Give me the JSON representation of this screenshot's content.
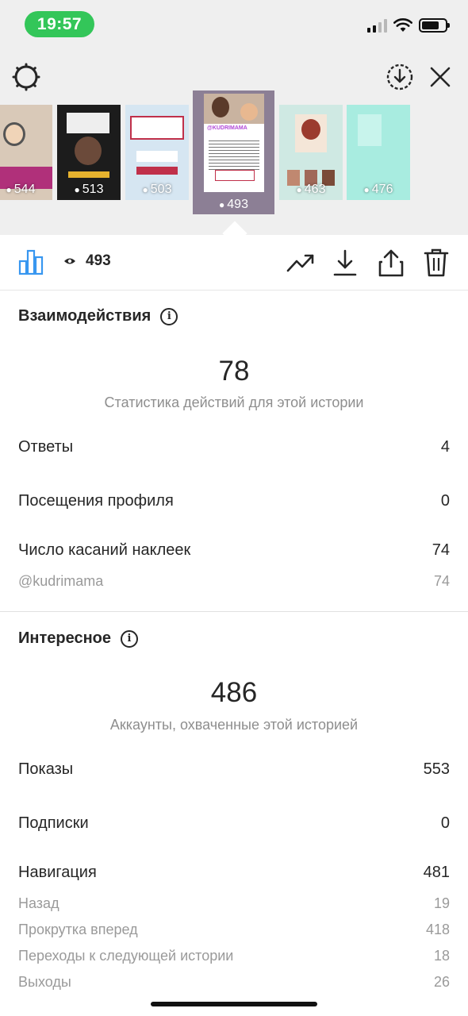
{
  "status_bar": {
    "time": "19:57"
  },
  "thumbnails": [
    {
      "views": "544",
      "bg": "#d9c9b8",
      "accent": "#b0307a"
    },
    {
      "views": "513",
      "bg": "#1c1c1c",
      "accent": "#e6b22e"
    },
    {
      "views": "503",
      "bg": "#d6e6f2",
      "accent": "#c0304a"
    },
    {
      "views": "463",
      "bg": "#cfe9e3",
      "accent": "#9b3b2e"
    },
    {
      "views": "476",
      "bg": "#a8ece0",
      "accent": "#7fcfc0"
    }
  ],
  "selected_thumb": {
    "views": "493",
    "logo": "@KUDRIMAMA"
  },
  "toolbar": {
    "views": "493"
  },
  "interactions": {
    "title": "Взаимодействия",
    "total": "78",
    "total_caption": "Статистика действий для этой истории",
    "rows": [
      {
        "label": "Ответы",
        "value": "4"
      },
      {
        "label": "Посещения профиля",
        "value": "0"
      },
      {
        "label": "Число касаний наклеек",
        "value": "74"
      }
    ],
    "sticker_sub": {
      "label": "@kudrimama",
      "value": "74"
    }
  },
  "discovery": {
    "title": "Интересное",
    "total": "486",
    "total_caption": "Аккаунты, охваченные этой историей",
    "rows": [
      {
        "label": "Показы",
        "value": "553"
      },
      {
        "label": "Подписки",
        "value": "0"
      },
      {
        "label": "Навигация",
        "value": "481"
      }
    ],
    "navigation_sub": [
      {
        "label": "Назад",
        "value": "19"
      },
      {
        "label": "Прокрутка вперед",
        "value": "418"
      },
      {
        "label": "Переходы к следующей истории",
        "value": "18"
      },
      {
        "label": "Выходы",
        "value": "26"
      }
    ]
  },
  "icons": {
    "settings": "gear-icon",
    "save": "download-circle-icon",
    "close": "close-icon",
    "insights": "bar-chart-icon",
    "eye": "eye-icon",
    "promote": "trend-up-icon",
    "download": "download-icon",
    "share": "share-icon",
    "delete": "trash-icon"
  },
  "colors": {
    "status_time_pill": "#33c659",
    "accent_blue": "#3897f0"
  }
}
